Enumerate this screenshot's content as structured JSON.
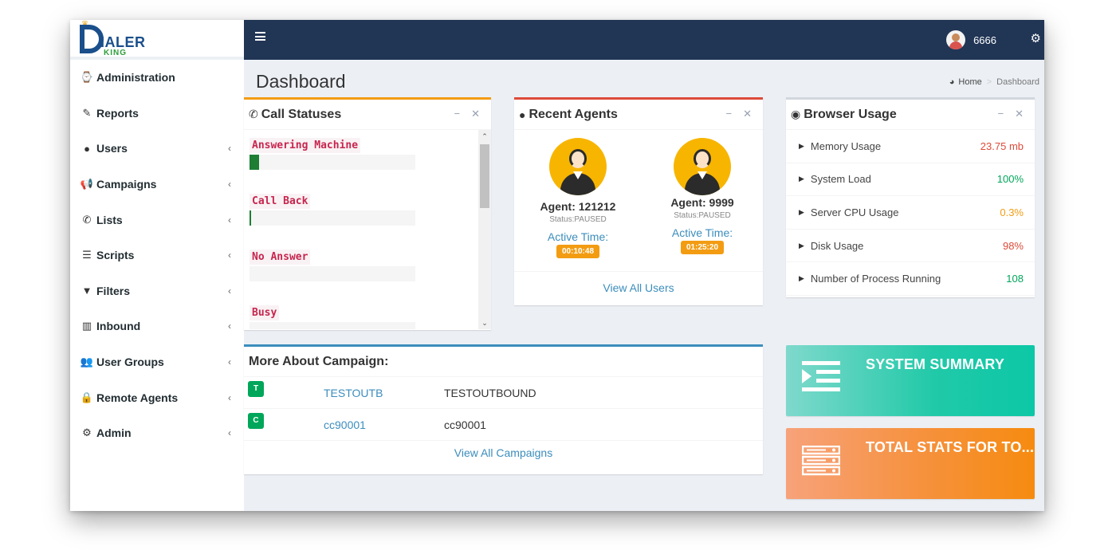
{
  "brand": {
    "name": "IALER",
    "sub": "KING"
  },
  "sidebar": {
    "items": [
      {
        "label": "Administration",
        "icon": "dashboard-icon",
        "glyph": "⌚",
        "has_children": false
      },
      {
        "label": "Reports",
        "icon": "edit-icon",
        "glyph": "✎",
        "has_children": false
      },
      {
        "label": "Users",
        "icon": "user-icon",
        "glyph": "●",
        "has_children": true
      },
      {
        "label": "Campaigns",
        "icon": "bullhorn-icon",
        "glyph": "📢",
        "has_children": true
      },
      {
        "label": "Lists",
        "icon": "phone-icon",
        "glyph": "✆",
        "has_children": true
      },
      {
        "label": "Scripts",
        "icon": "file-icon",
        "glyph": "☰",
        "has_children": true
      },
      {
        "label": "Filters",
        "icon": "filter-icon",
        "glyph": "▼",
        "has_children": true
      },
      {
        "label": "Inbound",
        "icon": "bar-chart-icon",
        "glyph": "▥",
        "has_children": true
      },
      {
        "label": "User Groups",
        "icon": "users-icon",
        "glyph": "👥",
        "has_children": true
      },
      {
        "label": "Remote Agents",
        "icon": "lock-icon",
        "glyph": "🔒",
        "has_children": true
      },
      {
        "label": "Admin",
        "icon": "gear-icon",
        "glyph": "⚙",
        "has_children": true
      }
    ],
    "chevron": "‹"
  },
  "header": {
    "username": "6666",
    "settings_glyph": "⚙"
  },
  "page": {
    "title": "Dashboard",
    "breadcrumb": {
      "home": "Home",
      "current": "Dashboard",
      "separator": ">"
    }
  },
  "call_statuses": {
    "title": "Call Statuses",
    "items": [
      {
        "label": "Answering Machine",
        "fill": 0.06
      },
      {
        "label": "Call Back",
        "fill": 0.01
      },
      {
        "label": "No Answer",
        "fill": 0.0
      },
      {
        "label": "Busy",
        "fill": 0.0
      }
    ]
  },
  "recent_agents": {
    "title": "Recent Agents",
    "agents": [
      {
        "name": "Agent: 121212",
        "status": "Status:PAUSED",
        "active_label": "Active Time:",
        "time": "00:10:48"
      },
      {
        "name": "Agent: 9999",
        "status": "Status:PAUSED",
        "active_label": "Active Time:",
        "time": "01:25:20"
      }
    ],
    "view_all": "View All Users"
  },
  "browser_usage": {
    "title": "Browser Usage",
    "items": [
      {
        "label": "Memory Usage",
        "value": "23.75 mb",
        "color": "#dd4b39"
      },
      {
        "label": "System Load",
        "value": "100%",
        "color": "#00a65a"
      },
      {
        "label": "Server CPU Usage",
        "value": "0.3%",
        "color": "#f39c12"
      },
      {
        "label": "Disk Usage",
        "value": "98%",
        "color": "#dd4b39"
      },
      {
        "label": "Number of Process Running",
        "value": "108",
        "color": "#00a65a"
      }
    ]
  },
  "campaigns": {
    "title": "More About Campaign:",
    "rows": [
      {
        "badge": "T",
        "id": "TESTOUTB",
        "name": "TESTOUTBOUND"
      },
      {
        "badge": "C",
        "id": "cc90001",
        "name": "cc90001"
      }
    ],
    "view_all": "View All Campaigns"
  },
  "info_boxes": [
    {
      "title": "SYSTEM SUMMARY",
      "icon": "indent-list-icon"
    },
    {
      "title": "TOTAL STATS FOR TO...",
      "icon": "server-icon"
    }
  ],
  "colors": {
    "topbar": "#213555",
    "accent_blue": "#3c8dbc",
    "warning": "#f39c12",
    "danger": "#dd4b39",
    "success": "#00a65a"
  }
}
